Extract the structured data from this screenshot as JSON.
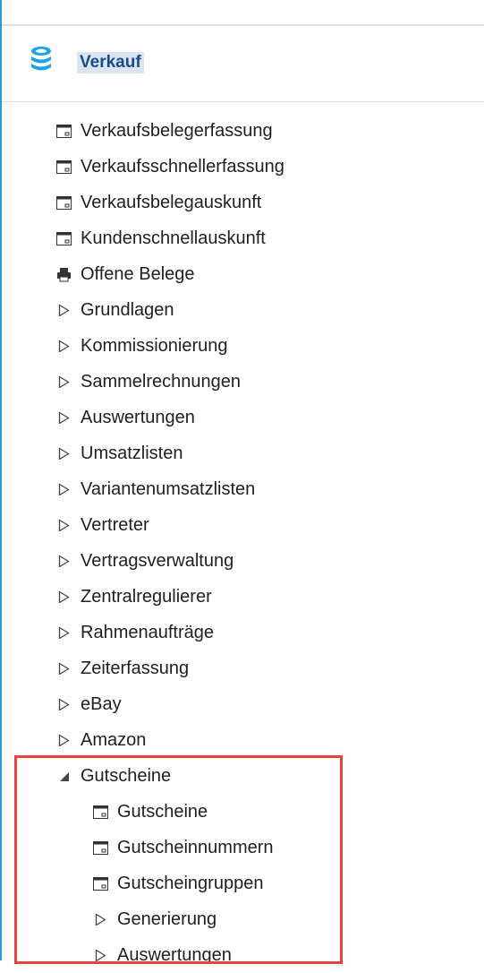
{
  "colors": {
    "accent_border": "#2b9be0",
    "header_text": "#1b4b8a",
    "header_highlight": "#dbe4f1",
    "highlight_frame": "#e8413f"
  },
  "header": {
    "icon": "coins-stack-icon",
    "title": "Verkauf"
  },
  "menu": {
    "items": [
      {
        "label": "Verkaufsbelegerfassung",
        "icon": "window-icon"
      },
      {
        "label": "Verkaufsschnellerfassung",
        "icon": "window-icon"
      },
      {
        "label": "Verkaufsbelegauskunft",
        "icon": "window-icon"
      },
      {
        "label": "Kundenschnellauskunft",
        "icon": "window-icon"
      },
      {
        "label": "Offene Belege",
        "icon": "printer-icon"
      },
      {
        "label": "Grundlagen",
        "icon": "expand-arrow-icon"
      },
      {
        "label": "Kommissionierung",
        "icon": "expand-arrow-icon"
      },
      {
        "label": "Sammelrechnungen",
        "icon": "expand-arrow-icon"
      },
      {
        "label": "Auswertungen",
        "icon": "expand-arrow-icon"
      },
      {
        "label": "Umsatzlisten",
        "icon": "expand-arrow-icon"
      },
      {
        "label": "Variantenumsatzlisten",
        "icon": "expand-arrow-icon"
      },
      {
        "label": "Vertreter",
        "icon": "expand-arrow-icon"
      },
      {
        "label": "Vertragsverwaltung",
        "icon": "expand-arrow-icon"
      },
      {
        "label": "Zentralregulierer",
        "icon": "expand-arrow-icon"
      },
      {
        "label": "Rahmenaufträge",
        "icon": "expand-arrow-icon"
      },
      {
        "label": "Zeiterfassung",
        "icon": "expand-arrow-icon"
      },
      {
        "label": "eBay",
        "icon": "expand-arrow-icon"
      },
      {
        "label": "Amazon",
        "icon": "expand-arrow-icon"
      },
      {
        "label": "Gutscheine",
        "icon": "collapse-arrow-icon"
      }
    ],
    "gutscheine_children": [
      {
        "label": "Gutscheine",
        "icon": "window-icon"
      },
      {
        "label": "Gutscheinnummern",
        "icon": "window-icon"
      },
      {
        "label": "Gutscheingruppen",
        "icon": "window-icon"
      },
      {
        "label": "Generierung",
        "icon": "expand-arrow-icon"
      },
      {
        "label": "Auswertungen",
        "icon": "expand-arrow-icon"
      }
    ]
  }
}
